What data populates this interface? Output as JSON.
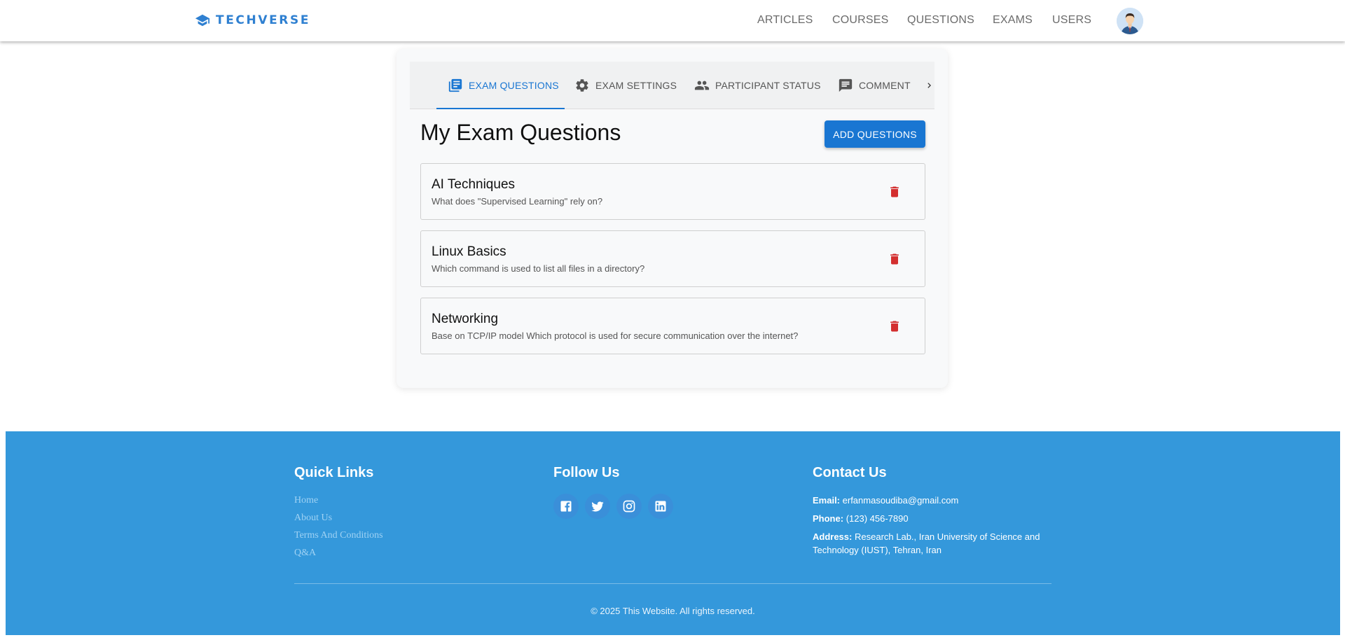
{
  "header": {
    "brand": "TECHVERSE",
    "nav": [
      {
        "label": "ARTICLES"
      },
      {
        "label": "COURSES"
      },
      {
        "label": "QUESTIONS"
      },
      {
        "label": "EXAMS"
      },
      {
        "label": "USERS"
      }
    ]
  },
  "tabs": [
    {
      "label": "EXAM QUESTIONS",
      "icon": "library-books-icon",
      "active": true
    },
    {
      "label": "EXAM SETTINGS",
      "icon": "gear-icon",
      "active": false
    },
    {
      "label": "PARTICIPANT STATUS",
      "icon": "people-icon",
      "active": false
    },
    {
      "label": "COMMENT",
      "icon": "comment-icon",
      "active": false
    }
  ],
  "main": {
    "title": "My Exam Questions",
    "add_button": "ADD QUESTIONS",
    "questions": [
      {
        "title": "AI Techniques",
        "text": "What does \"Supervised Learning\" rely on?"
      },
      {
        "title": "Linux Basics",
        "text": "Which command is used to list all files in a directory?"
      },
      {
        "title": "Networking",
        "text": "Base on TCP/IP model Which protocol is used for secure communication over the internet?"
      }
    ]
  },
  "footer": {
    "quick_links_title": "Quick Links",
    "quick_links": [
      "Home",
      "About Us",
      "Terms And Conditions",
      "Q&A"
    ],
    "follow_title": "Follow Us",
    "social": [
      "facebook-icon",
      "twitter-icon",
      "instagram-icon",
      "linkedin-icon"
    ],
    "contact_title": "Contact Us",
    "email_label": "Email:",
    "email": "erfanmasoudiba@gmail.com",
    "phone_label": "Phone:",
    "phone": "(123) 456-7890",
    "address_label": "Address:",
    "address": "Research Lab., Iran University of Science and Technology (IUST), Tehran, Iran",
    "copyright": "© 2025 This Website. All rights reserved."
  },
  "colors": {
    "primary": "#1976d2",
    "brand": "#2f80d1",
    "footer_bg": "#3498db",
    "delete": "#d32f2f"
  }
}
